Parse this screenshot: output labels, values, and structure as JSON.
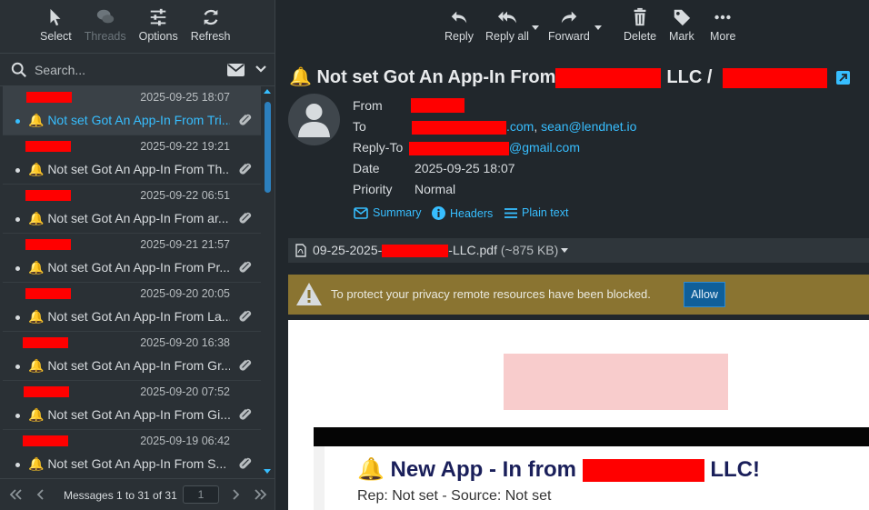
{
  "left_toolbar": {
    "buttons": [
      {
        "label": "Select",
        "icon": "pointer-icon",
        "enabled": true
      },
      {
        "label": "Threads",
        "icon": "threads-icon",
        "enabled": false
      },
      {
        "label": "Options",
        "icon": "options-sliders-icon",
        "enabled": true
      },
      {
        "label": "Refresh",
        "icon": "refresh-icon",
        "enabled": true
      }
    ]
  },
  "search": {
    "placeholder": "Search...",
    "value": ""
  },
  "messages": [
    {
      "date": "2025-09-25 18:07",
      "subject": "🔔 Not set Got An App-In From Tri...",
      "selected": true,
      "attachment": true
    },
    {
      "date": "2025-09-22 19:21",
      "subject": "🔔 Not set Got An App-In From Th...",
      "selected": false,
      "attachment": true
    },
    {
      "date": "2025-09-22 06:51",
      "subject": "🔔 Not set Got An App-In From ar...",
      "selected": false,
      "attachment": true
    },
    {
      "date": "2025-09-21 21:57",
      "subject": "🔔 Not set Got An App-In From Pr...",
      "selected": false,
      "attachment": true
    },
    {
      "date": "2025-09-20 20:05",
      "subject": "🔔 Not set Got An App-In From La...",
      "selected": false,
      "attachment": true
    },
    {
      "date": "2025-09-20 16:38",
      "subject": "🔔 Not set Got An App-In From Gr...",
      "selected": false,
      "attachment": true
    },
    {
      "date": "2025-09-20 07:52",
      "subject": "🔔 Not set Got An App-In From Gi...",
      "selected": false,
      "attachment": true
    },
    {
      "date": "2025-09-19 06:42",
      "subject": "🔔 Not set Got An App-In From S...",
      "selected": false,
      "attachment": true
    }
  ],
  "pager": {
    "label": "Messages 1 to 31 of 31",
    "page": "1"
  },
  "right_toolbar": {
    "reply": "Reply",
    "reply_all": "Reply all",
    "forward": "Forward",
    "delete": "Delete",
    "mark": "Mark",
    "more": "More"
  },
  "message": {
    "subject_prefix": "🔔 Not set Got An App-In From",
    "subject_mid": "LLC /",
    "headers": {
      "from_label": "From",
      "to_label": "To",
      "to_suffix": ".com",
      "to_second": "sean@lendnet.io",
      "replyto_label": "Reply-To",
      "replyto_suffix": "@gmail.com",
      "date_label": "Date",
      "date_value": "2025-09-25 18:07",
      "priority_label": "Priority",
      "priority_value": "Normal"
    },
    "links": {
      "summary": "Summary",
      "headers": "Headers",
      "plain_text": "Plain text"
    },
    "attachment": {
      "prefix": "09-25-2025-",
      "suffix": "-LLC.pdf",
      "size": "(~875 KB)"
    },
    "remote_notice": "To protect your privacy remote resources have been blocked.",
    "allow_label": "Allow",
    "body": {
      "heading_prefix": "🔔 New App - In from",
      "heading_suffix": "LLC!",
      "subline": "Rep: Not set - Source: Not set"
    }
  },
  "colors": {
    "accent": "#37beff",
    "redaction": "#ff0000",
    "notice_bg": "#8a7431",
    "allow_bg": "#0f5f99"
  }
}
